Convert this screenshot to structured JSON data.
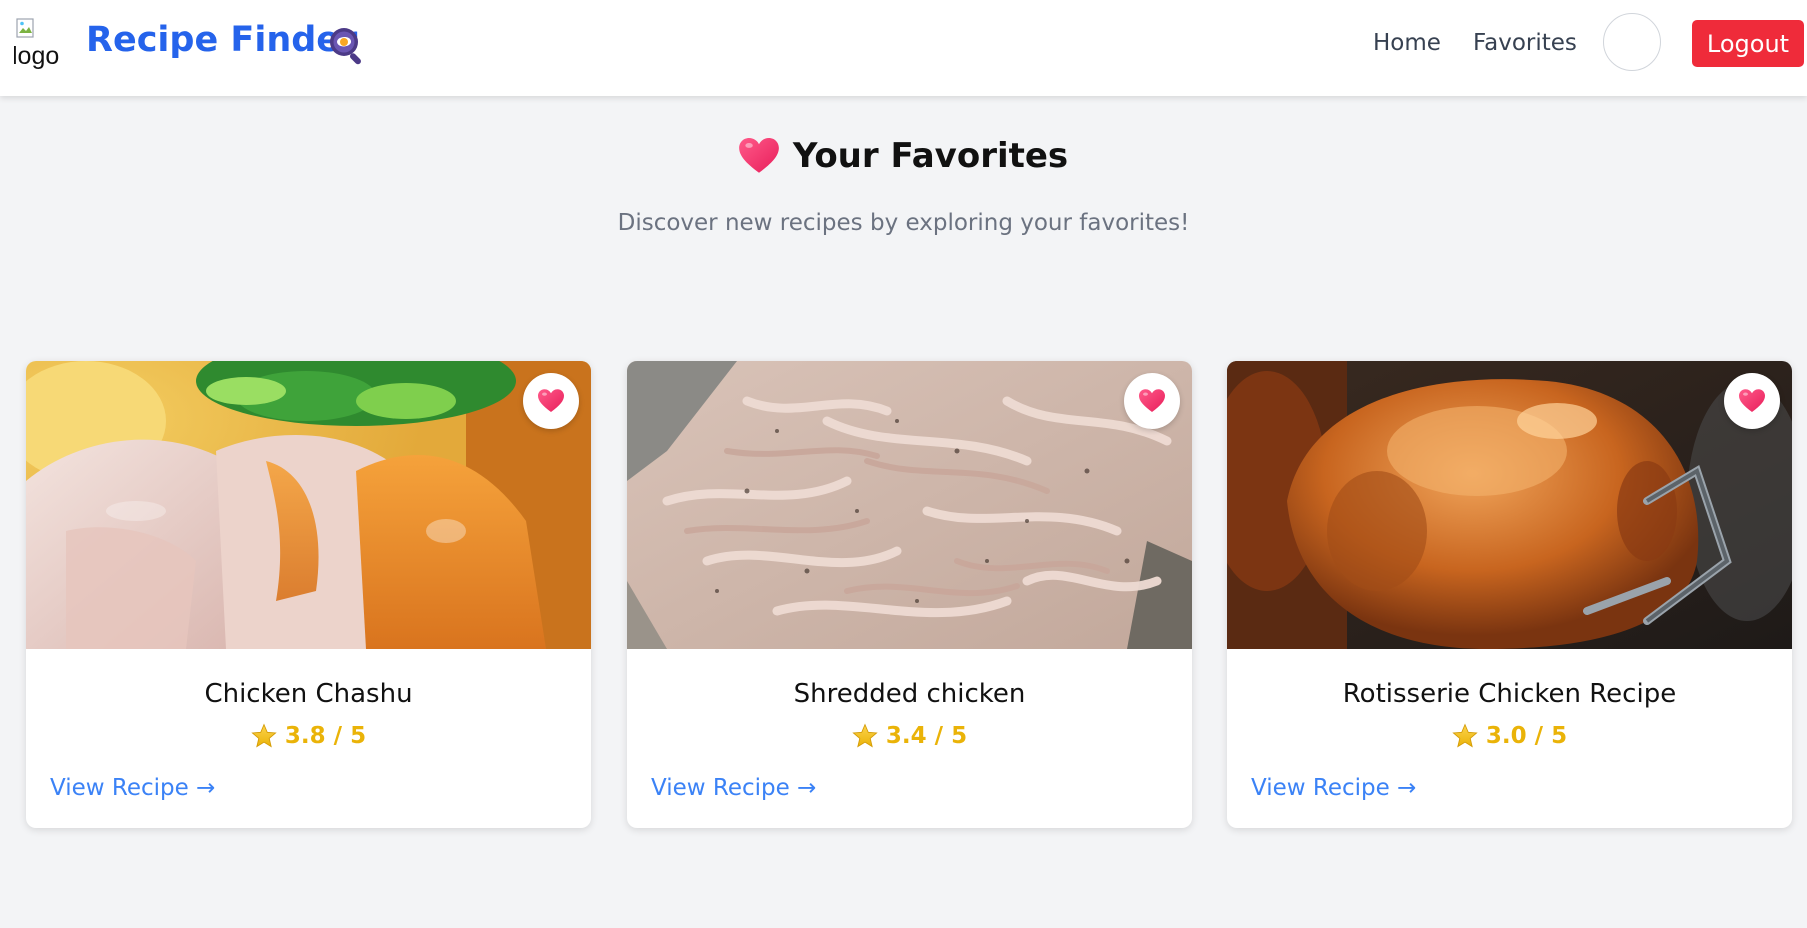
{
  "navbar": {
    "logo_alt": "logo",
    "brand": "Recipe Finder",
    "links": [
      {
        "label": "Home"
      },
      {
        "label": "Favorites"
      }
    ],
    "logout_label": "Logout",
    "brand_color": "#2563eb",
    "logout_color": "#ef2b3a"
  },
  "header": {
    "title": "Your Favorites",
    "subtitle": "Discover new recipes by exploring your favorites!",
    "icon": "heart-icon"
  },
  "favorites": [
    {
      "title": "Chicken Chashu",
      "rating": "3.8 / 5",
      "link": "View Recipe →",
      "image": "chicken-chashu-photo"
    },
    {
      "title": "Shredded chicken",
      "rating": "3.4 / 5",
      "link": "View Recipe →",
      "image": "shredded-chicken-photo"
    },
    {
      "title": "Rotisserie Chicken Recipe",
      "rating": "3.0 / 5",
      "link": "View Recipe →",
      "image": "rotisserie-chicken-photo"
    }
  ],
  "colors": {
    "accent": "#3b82f6",
    "rating": "#eab308",
    "heart": "#f43f6e",
    "background": "#f3f4f6"
  }
}
